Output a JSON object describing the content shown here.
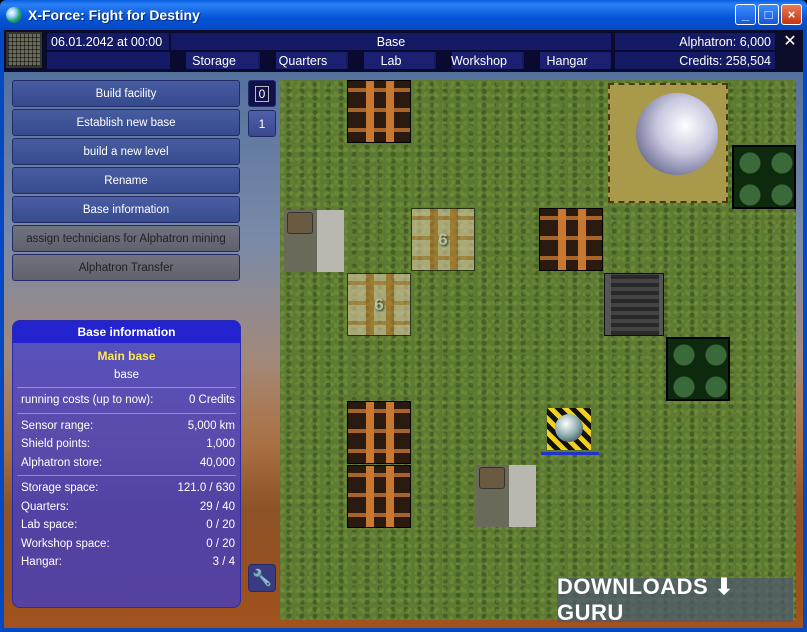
{
  "window": {
    "title": "X-Force: Fight for Destiny",
    "min": "_",
    "max": "□",
    "close": "×"
  },
  "topbar": {
    "date": "06.01.2042 at 00:00",
    "base_name": "Base",
    "alphatron": "Alphatron: 6,000",
    "credits": "Credits: 258,504",
    "close": "✕",
    "tabs": [
      "Storage",
      "Quarters",
      "Lab",
      "Workshop",
      "Hangar"
    ]
  },
  "menu": [
    {
      "label": "Build facility",
      "enabled": true
    },
    {
      "label": "Establish new base",
      "enabled": true
    },
    {
      "label": "build a new level",
      "enabled": true
    },
    {
      "label": "Rename",
      "enabled": true
    },
    {
      "label": "Base information",
      "enabled": true
    },
    {
      "label": "assign technicians for Alphatron mining",
      "enabled": false
    },
    {
      "label": "Alphatron Transfer",
      "enabled": false
    }
  ],
  "levels": [
    "0",
    "1"
  ],
  "info": {
    "header": "Base information",
    "base_name": "Main base",
    "base_type": "base",
    "running_costs": {
      "label": "running costs (up to now):",
      "value": "0 Credits"
    },
    "stats1": [
      {
        "label": "Sensor range:",
        "value": "5,000 km"
      },
      {
        "label": "Shield points:",
        "value": "1,000"
      },
      {
        "label": "Alphatron store:",
        "value": "40,000"
      }
    ],
    "stats2": [
      {
        "label": "Storage space:",
        "value": "121.0 / 630"
      },
      {
        "label": "Quarters:",
        "value": "29 / 40"
      },
      {
        "label": "Lab space:",
        "value": "0 / 20"
      },
      {
        "label": "Workshop space:",
        "value": "0 / 20"
      },
      {
        "label": "Hangar:",
        "value": "3 / 4"
      }
    ]
  },
  "map": {
    "construction_days_1": "6",
    "construction_days_2": "6"
  },
  "watermark": "DOWNLOADS ⬇ GURU",
  "colors": {
    "accent": "#0554d8",
    "panel": "#3c3cd2",
    "highlight": "#ffe94a"
  }
}
